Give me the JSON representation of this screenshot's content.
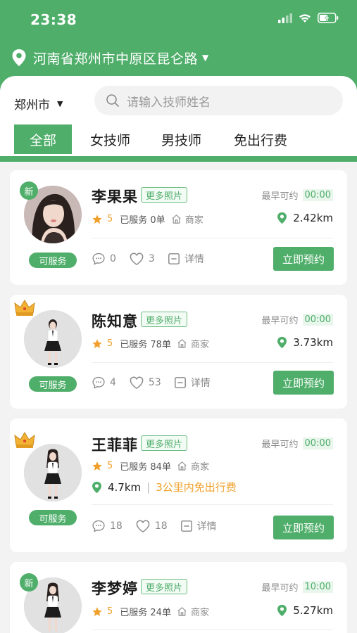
{
  "status_bar": {
    "time": "23:38"
  },
  "location": {
    "text": "河南省郑州市中原区昆仑路"
  },
  "city": {
    "label": "郑州市"
  },
  "search": {
    "placeholder": "请输入技师姓名"
  },
  "tabs": [
    {
      "label": "全部",
      "active": true
    },
    {
      "label": "女技师",
      "active": false
    },
    {
      "label": "男技师",
      "active": false
    },
    {
      "label": "免出行费",
      "active": false
    }
  ],
  "labels": {
    "more_photos": "更多照片",
    "earliest": "最早可约",
    "merchant": "商家",
    "details": "详情",
    "book": "立即预约",
    "available": "可服务"
  },
  "technicians": [
    {
      "badge": "新",
      "name": "李果果",
      "earliest_time": "00:00",
      "rating": "5",
      "served": "已服务 0单",
      "distance": "2.42km",
      "comments": "0",
      "likes": "3",
      "status": "可服务"
    },
    {
      "badge": "crown",
      "name": "陈知意",
      "earliest_time": "00:00",
      "rating": "5",
      "served": "已服务 78单",
      "distance": "3.73km",
      "comments": "4",
      "likes": "53",
      "status": "可服务"
    },
    {
      "badge": "crown",
      "name": "王菲菲",
      "earliest_time": "00:00",
      "rating": "5",
      "served": "已服务 84单",
      "distance": "4.7km",
      "free_fee": "3公里内免出行费",
      "comments": "18",
      "likes": "18",
      "status": "可服务"
    },
    {
      "badge": "新",
      "name": "李梦婷",
      "earliest_time": "10:00",
      "rating": "5",
      "served": "已服务 24单",
      "distance": "5.27km"
    }
  ],
  "colors": {
    "brand": "#4fae6a",
    "accent_orange": "#f0a02a"
  }
}
